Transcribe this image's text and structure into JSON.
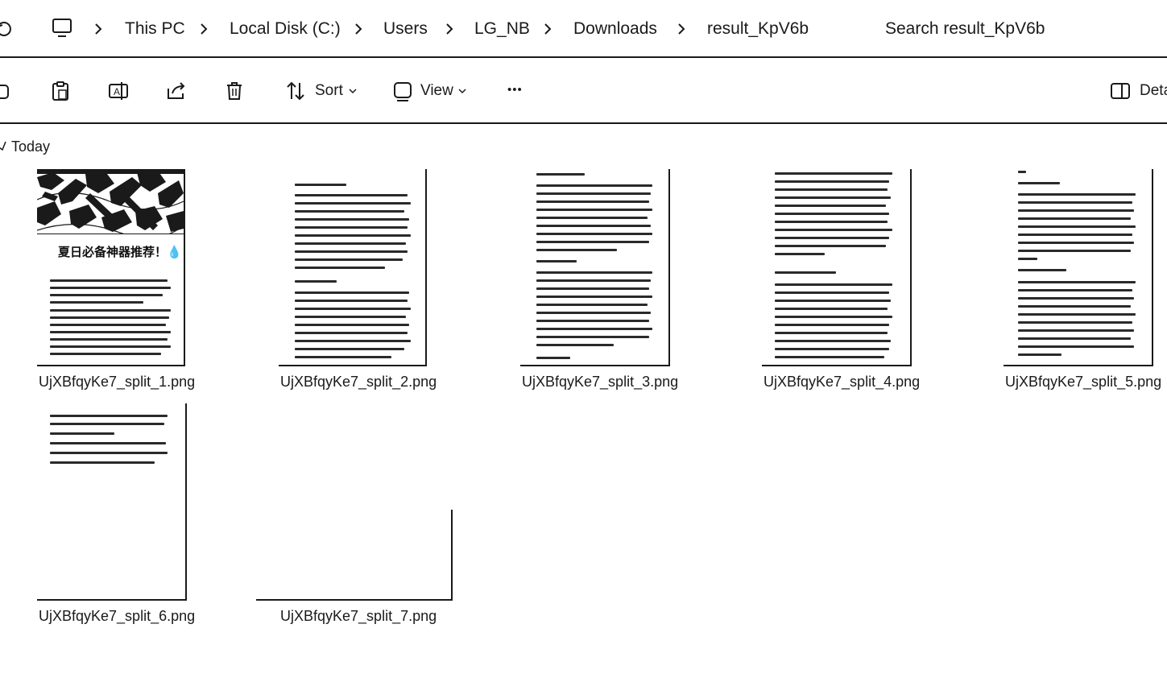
{
  "address_bar": {
    "breadcrumbs": [
      "This PC",
      "Local Disk (C:)",
      "Users",
      "LG_NB",
      "Downloads",
      "result_KpV6b"
    ],
    "search_placeholder": "Search result_KpV6b"
  },
  "toolbar": {
    "sort_label": "Sort",
    "view_label": "View",
    "more_label": "•••",
    "details_label": "Deta"
  },
  "group": {
    "label": "Today"
  },
  "files": [
    {
      "name": "UjXBfqyKe7_split_1.png",
      "heading": "夏日必备神器推荐！💧"
    },
    {
      "name": "UjXBfqyKe7_split_2.png"
    },
    {
      "name": "UjXBfqyKe7_split_3.png"
    },
    {
      "name": "UjXBfqyKe7_split_4.png"
    },
    {
      "name": "UjXBfqyKe7_split_5.png"
    },
    {
      "name": "UjXBfqyKe7_split_6.png"
    },
    {
      "name": "UjXBfqyKe7_split_7.png"
    }
  ]
}
